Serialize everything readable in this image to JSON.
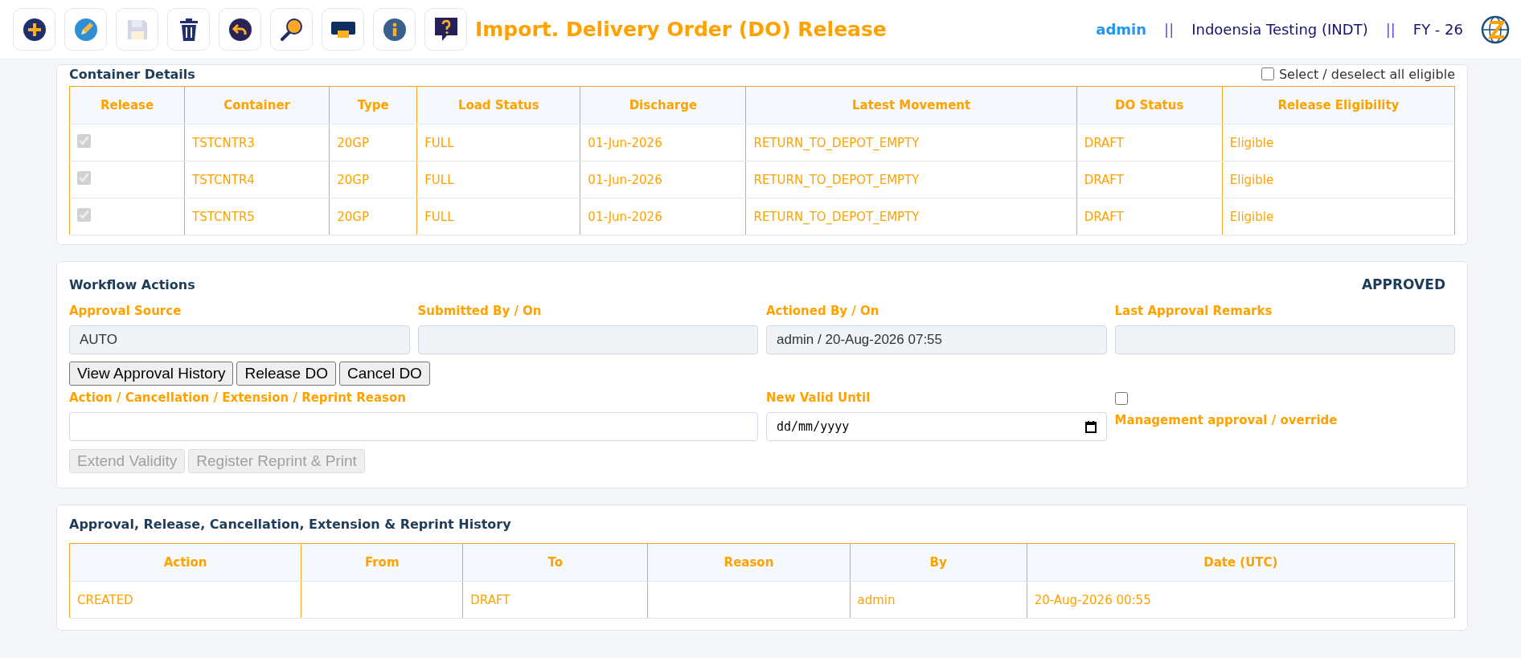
{
  "header": {
    "toolbar": [
      {
        "kind": "add",
        "disabled": false
      },
      {
        "kind": "edit",
        "disabled": false
      },
      {
        "kind": "save",
        "disabled": true
      },
      {
        "kind": "delete",
        "disabled": false
      },
      {
        "kind": "undo",
        "disabled": false
      },
      {
        "kind": "search",
        "disabled": false
      },
      {
        "kind": "print",
        "disabled": false
      },
      {
        "kind": "info",
        "disabled": false
      },
      {
        "kind": "help",
        "disabled": false
      }
    ],
    "title": "Import. Delivery Order (DO) Release",
    "user": "admin",
    "separator_1": "||",
    "company": "Indoensia Testing (INDT)",
    "separator_2": "||",
    "fiscal_year": "FY - 26"
  },
  "container_details": {
    "title": "Container Details",
    "select_all": {
      "label": "Select / deselect all eligible",
      "checked": false
    },
    "columns": [
      "Release",
      "Container",
      "Type",
      "Load Status",
      "Discharge",
      "Latest Movement",
      "DO Status",
      "Release Eligibility"
    ],
    "rows": [
      {
        "release": {
          "checked": true,
          "disabled": true
        },
        "container": "TSTCNTR3",
        "type": "20GP",
        "load_status": "FULL",
        "discharge": "01-Jun-2026",
        "latest_movement": "RETURN_TO_DEPOT_EMPTY",
        "do_status": "DRAFT",
        "release_eligibility": "Eligible"
      },
      {
        "release": {
          "checked": true,
          "disabled": true
        },
        "container": "TSTCNTR4",
        "type": "20GP",
        "load_status": "FULL",
        "discharge": "01-Jun-2026",
        "latest_movement": "RETURN_TO_DEPOT_EMPTY",
        "do_status": "DRAFT",
        "release_eligibility": "Eligible"
      },
      {
        "release": {
          "checked": true,
          "disabled": true
        },
        "container": "TSTCNTR5",
        "type": "20GP",
        "load_status": "FULL",
        "discharge": "01-Jun-2026",
        "latest_movement": "RETURN_TO_DEPOT_EMPTY",
        "do_status": "DRAFT",
        "release_eligibility": "Eligible"
      }
    ]
  },
  "workflow": {
    "title": "Workflow Actions",
    "status": "APPROVED",
    "fields": [
      {
        "label": "Approval Source",
        "value": "AUTO"
      },
      {
        "label": "Submitted By / On"
      },
      {
        "label": "Actioned By / On",
        "value": "admin / 20-Aug-2026 07:55"
      },
      {
        "label": "Last Approval Remarks"
      }
    ],
    "buttons": [
      {
        "label": "View Approval History",
        "disabled": false
      },
      {
        "label": "Release DO",
        "disabled": false
      },
      {
        "label": "Cancel DO",
        "disabled": false
      }
    ],
    "reason": {
      "label": "Action / Cancellation / Extension / Reprint Reason"
    },
    "valid_until": {
      "label": "New Valid Until",
      "placeholder": "dd/mm/yyyy"
    },
    "management_override": {
      "label": "Management approval / override",
      "checked": false
    },
    "secondary_buttons": [
      {
        "label": "Extend Validity",
        "disabled": true
      },
      {
        "label": "Register Reprint & Print",
        "disabled": true
      }
    ]
  },
  "history": {
    "title": "Approval, Release, Cancellation, Extension & Reprint History",
    "columns": [
      "Action",
      "From",
      "To",
      "Reason",
      "By",
      "Date (UTC)"
    ],
    "rows": [
      {
        "cells": [
          "CREATED",
          "",
          "DRAFT",
          "",
          "admin",
          "20-Aug-2026 00:55"
        ]
      }
    ]
  }
}
